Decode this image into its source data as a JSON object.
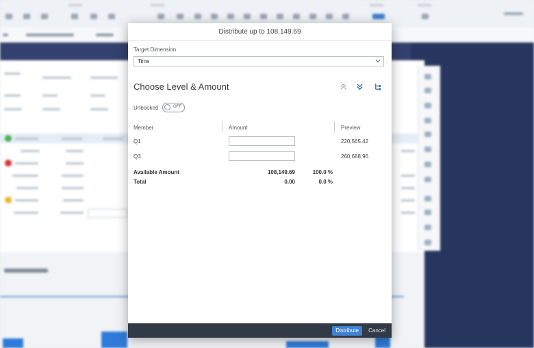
{
  "dialog": {
    "title": "Distribute up to 108,149.69",
    "target_dimension": {
      "label": "Target Dimension",
      "value": "Time"
    },
    "section_title": "Choose Level & Amount",
    "toolbar_icons": [
      "collapse-levels-icon",
      "expand-levels-icon",
      "hierarchy-icon"
    ],
    "unbooked": {
      "label": "Unbooked",
      "state": "OFF"
    },
    "columns": {
      "member": "Member",
      "amount": "Amount",
      "preview": "Preview"
    },
    "rows": [
      {
        "member": "Q1",
        "amount": "",
        "preview": "220,565.42"
      },
      {
        "member": "Q3",
        "amount": "",
        "preview": "260,688.96"
      }
    ],
    "summary": {
      "available": {
        "label": "Available Amount",
        "amount": "108,149.69",
        "percent": "100.0 %"
      },
      "total": {
        "label": "Total",
        "amount": "0.00",
        "percent": "0.0 %"
      }
    },
    "footer": {
      "distribute_label": "Distribute",
      "cancel_label": "Cancel"
    }
  },
  "colors": {
    "accent": "#3e82d1",
    "footer_bg": "#323a45",
    "backdrop_dark": "#27365f"
  }
}
